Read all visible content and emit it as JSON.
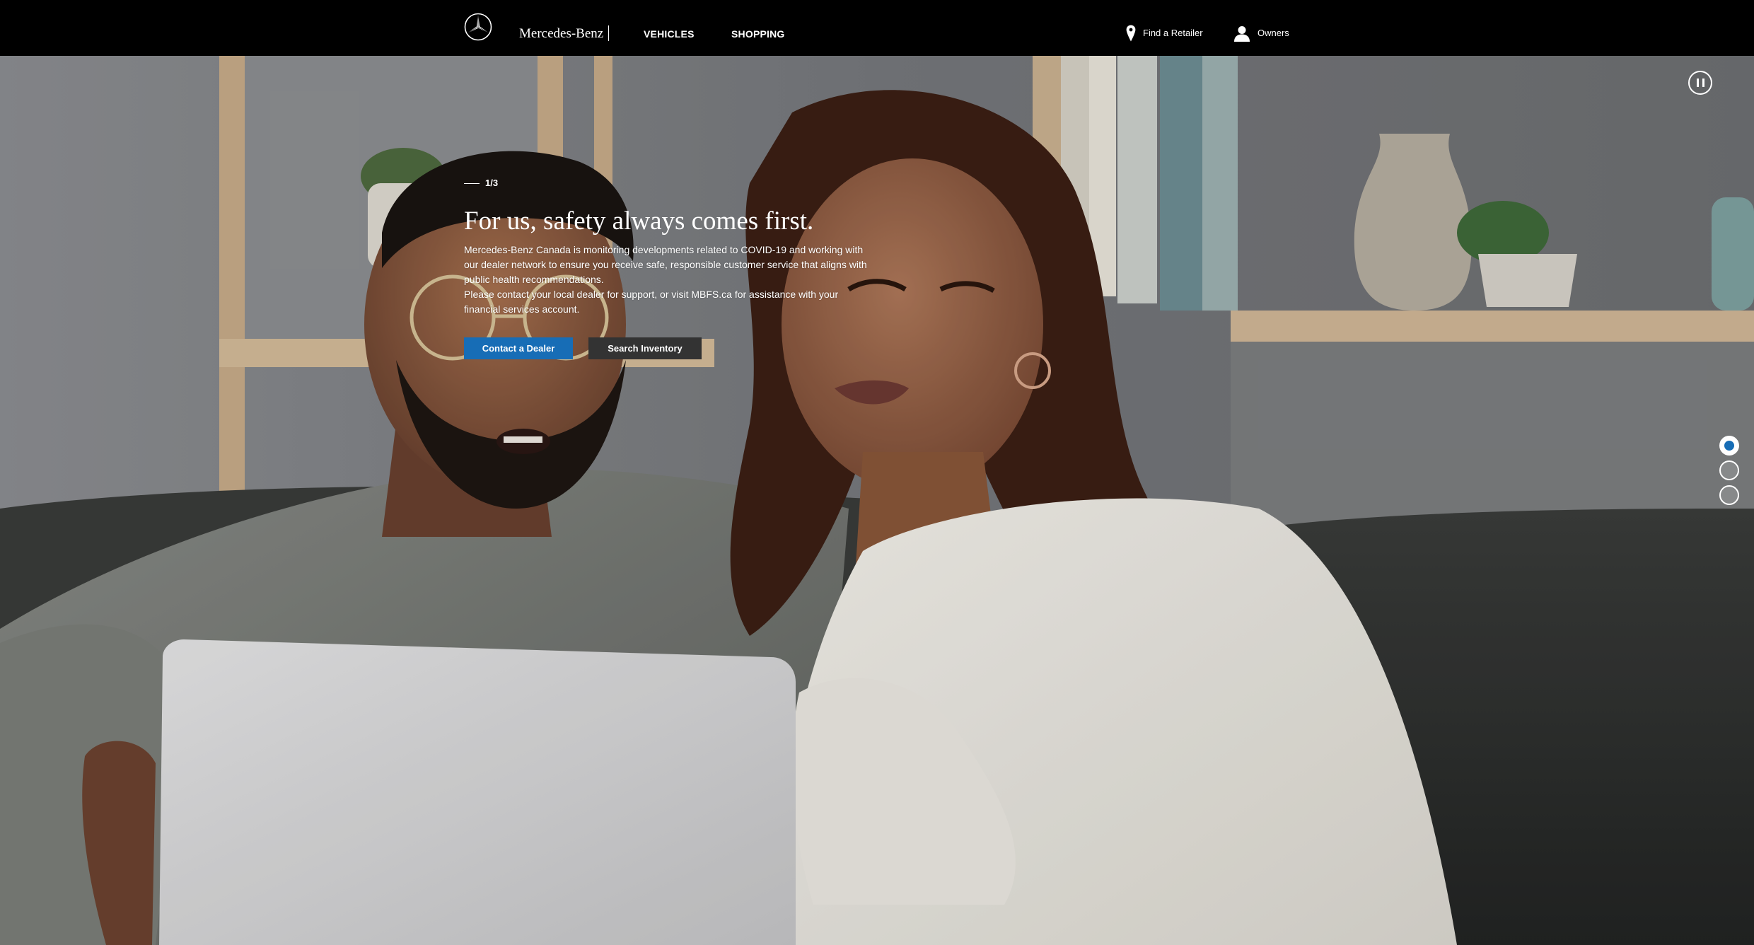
{
  "header": {
    "brand": "Mercedes-Benz",
    "logo_icon": "mercedes-star-icon",
    "nav": {
      "vehicles": "VEHICLES",
      "shopping": "SHOPPING"
    },
    "utility": {
      "find_retailer": "Find a Retailer",
      "find_retailer_icon": "location-pin-icon",
      "owners": "Owners",
      "owners_icon": "user-icon"
    }
  },
  "hero": {
    "slide_indicator": "1/3",
    "headline": "For us, safety always comes first.",
    "body": [
      "Mercedes-Benz Canada is monitoring developments related to COVID-19 and working with our dealer network to ensure you receive safe, responsible customer service that aligns with public health recommendations.",
      "Please contact your local dealer for support, or visit MBFS.ca for assistance with your financial services account."
    ],
    "buttons": {
      "primary": "Contact a Dealer",
      "secondary": "Search Inventory"
    },
    "image_description_icon": "hero-photo-couple-laptop"
  },
  "carousel": {
    "pause_icon": "pause-icon",
    "slides_total": 3,
    "active_slide": 1
  },
  "colors": {
    "topbar": "#000000",
    "primary_button": "#176db6",
    "secondary_button": "#333333",
    "text": "#ffffff"
  }
}
